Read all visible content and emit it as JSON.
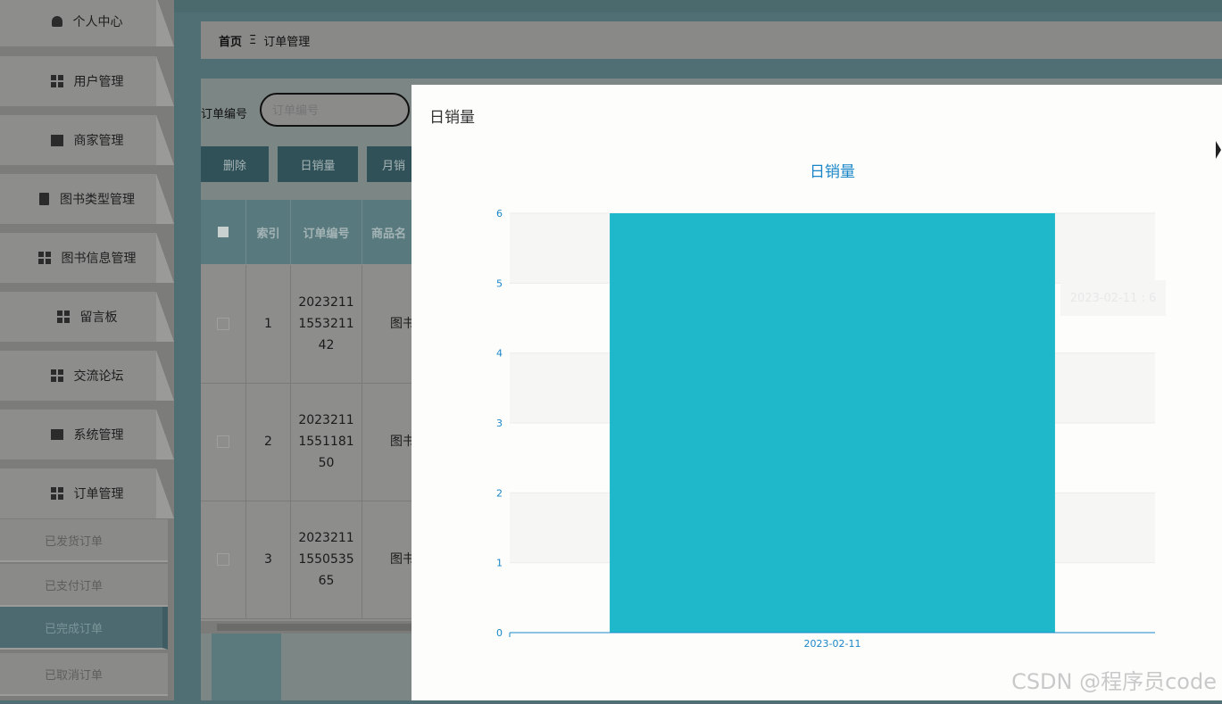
{
  "sidebar": {
    "items": [
      {
        "label": "个人中心",
        "icon": "user-icon"
      },
      {
        "label": "用户管理",
        "icon": "grid-icon"
      },
      {
        "label": "商家管理",
        "icon": "monitor-icon"
      },
      {
        "label": "图书类型管理",
        "icon": "clipboard-icon"
      },
      {
        "label": "图书信息管理",
        "icon": "grid-icon"
      },
      {
        "label": "留言板",
        "icon": "grid-icon"
      },
      {
        "label": "交流论坛",
        "icon": "grid-icon"
      },
      {
        "label": "系统管理",
        "icon": "book-icon"
      },
      {
        "label": "订单管理",
        "icon": "grid-icon"
      }
    ],
    "sub_items": [
      {
        "label": "已发货订单"
      },
      {
        "label": "已支付订单"
      },
      {
        "label": "已完成订单",
        "active": true
      },
      {
        "label": "已取消订单"
      }
    ]
  },
  "breadcrumb": {
    "home": "首页",
    "separator": "Ξ",
    "current": "订单管理"
  },
  "search": {
    "label": "订单编号",
    "placeholder": "订单编号"
  },
  "toolbar": {
    "delete": "删除",
    "daily_sales": "日销量",
    "monthly_sales": "月销"
  },
  "table": {
    "headers": [
      "索引",
      "订单编号",
      "商品名"
    ],
    "rows": [
      {
        "index": "1",
        "order_no_lines": [
          "2023211",
          "1553211",
          "42"
        ],
        "product": "图书"
      },
      {
        "index": "2",
        "order_no_lines": [
          "2023211",
          "1551181",
          "50"
        ],
        "product": "图书"
      },
      {
        "index": "3",
        "order_no_lines": [
          "2023211",
          "1550535",
          "65"
        ],
        "product": "图书"
      }
    ]
  },
  "dialog": {
    "title": "日销量"
  },
  "chart_data": {
    "type": "bar",
    "title": "日销量",
    "categories": [
      "2023-02-11"
    ],
    "values": [
      6
    ],
    "ylim": [
      0,
      6
    ],
    "yticks": [
      0,
      1,
      2,
      3,
      4,
      5,
      6
    ],
    "bar_color": "#1fb8cb",
    "axis_color": "#1a86c8",
    "title_color": "#1a86c8",
    "tooltip": "2023-02-11 : 6"
  },
  "watermark": "CSDN @程序员code"
}
